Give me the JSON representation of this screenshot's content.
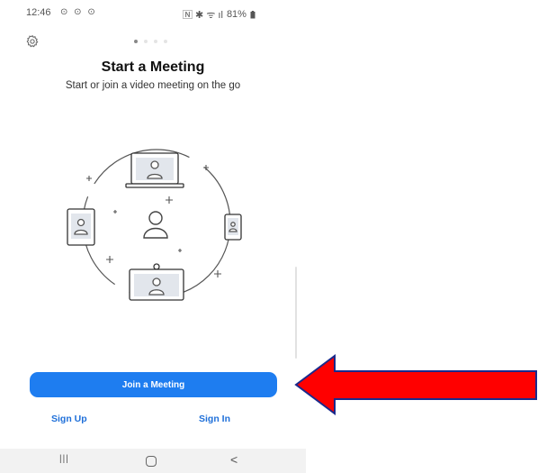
{
  "status_bar": {
    "time": "12:46",
    "notifications": "⊙ ⊙ ⊙",
    "icons_text": "🄽 ✱ ᯤ ıl",
    "battery": "81%"
  },
  "onboarding": {
    "page_index": 1,
    "page_count": 4,
    "title": "Start a Meeting",
    "subtitle": "Start or join a video meeting on the go"
  },
  "actions": {
    "join_label": "Join a Meeting",
    "signup_label": "Sign Up",
    "signin_label": "Sign In"
  },
  "nav_bar": {
    "recent": "|||",
    "back": "<"
  },
  "colors": {
    "accent": "#1e7df0",
    "link": "#1e6fd9",
    "annotation_arrow": "#ff0000",
    "annotation_outline": "#1a2a8c"
  }
}
